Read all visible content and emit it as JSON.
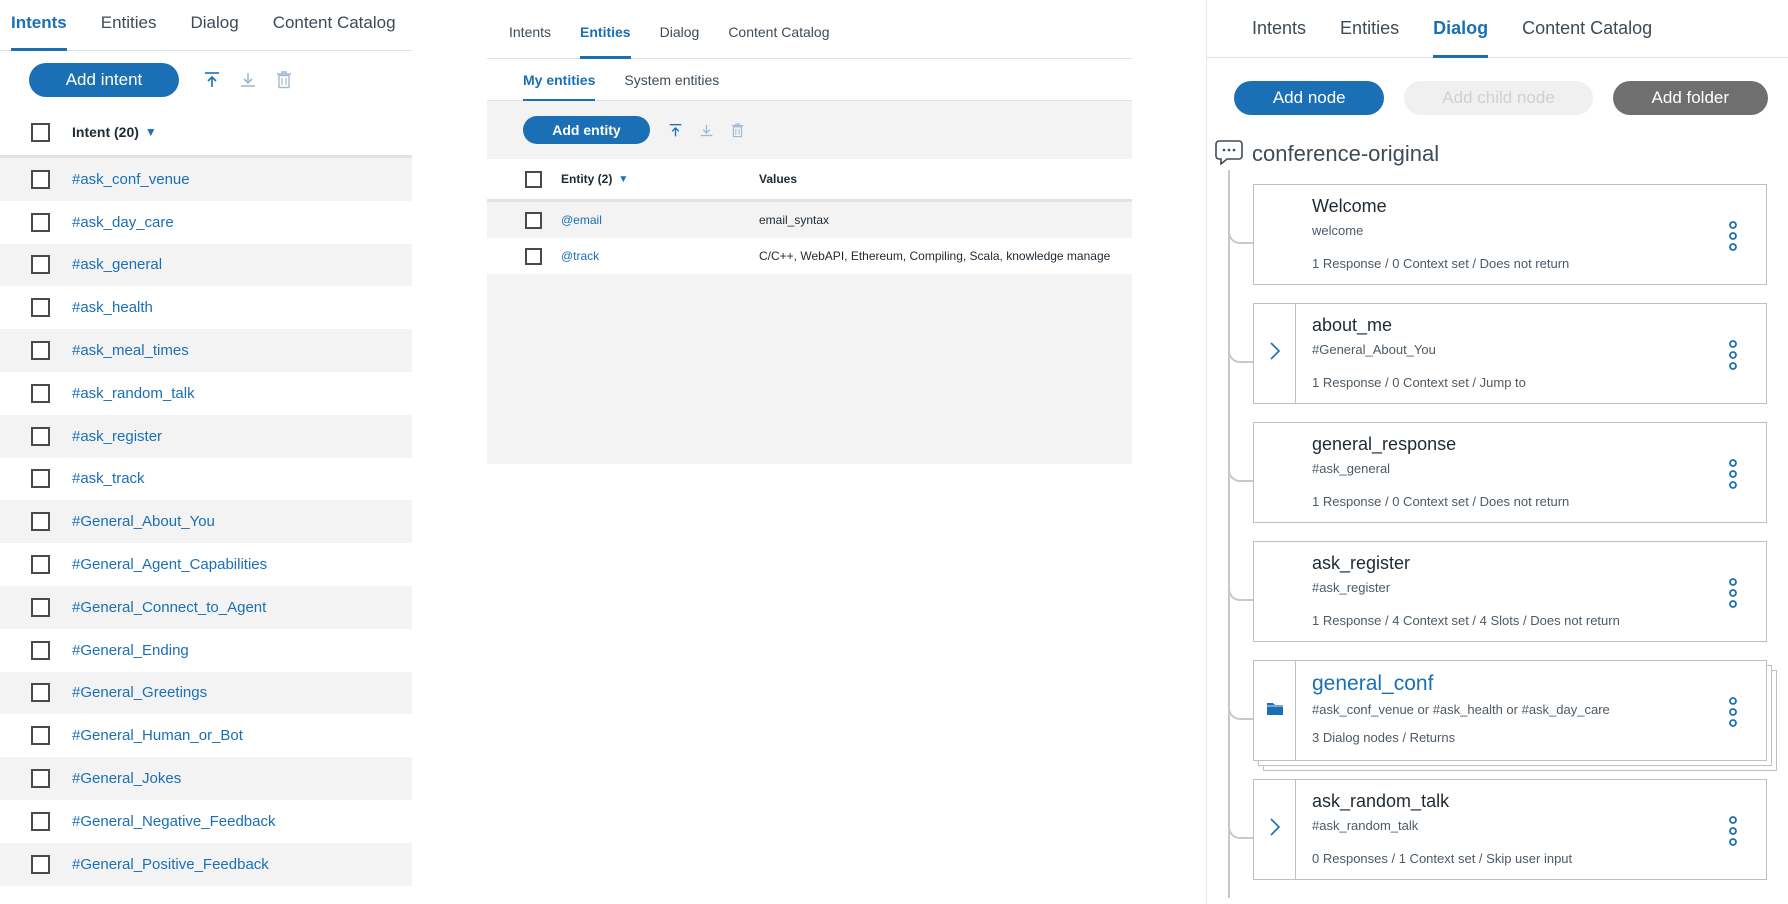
{
  "intents_panel": {
    "tabs": [
      "Intents",
      "Entities",
      "Dialog",
      "Content Catalog"
    ],
    "active_tab": 0,
    "add_button": "Add intent",
    "header_label": "Intent (20)",
    "items": [
      "#ask_conf_venue",
      "#ask_day_care",
      "#ask_general",
      "#ask_health",
      "#ask_meal_times",
      "#ask_random_talk",
      "#ask_register",
      "#ask_track",
      "#General_About_You",
      "#General_Agent_Capabilities",
      "#General_Connect_to_Agent",
      "#General_Ending",
      "#General_Greetings",
      "#General_Human_or_Bot",
      "#General_Jokes",
      "#General_Negative_Feedback",
      "#General_Positive_Feedback"
    ]
  },
  "entities_panel": {
    "tabs": [
      "Intents",
      "Entities",
      "Dialog",
      "Content Catalog"
    ],
    "active_tab": 1,
    "subtabs": [
      "My entities",
      "System entities"
    ],
    "active_subtab": 0,
    "add_button": "Add entity",
    "col_entity": "Entity (2)",
    "col_values": "Values",
    "rows": [
      {
        "name": "@email",
        "values": "email_syntax"
      },
      {
        "name": "@track",
        "values": "C/C++, WebAPI, Ethereum, Compiling, Scala, knowledge manage"
      }
    ]
  },
  "dialog_panel": {
    "tabs": [
      "Intents",
      "Entities",
      "Dialog",
      "Content Catalog"
    ],
    "active_tab": 2,
    "add_node": "Add node",
    "add_child_node": "Add child node",
    "add_folder": "Add folder",
    "workspace_name": "conference-original",
    "nodes": [
      {
        "name": "Welcome",
        "condition": "welcome",
        "meta": "1 Response / 0 Context set / Does not return",
        "gutter": "none"
      },
      {
        "name": "about_me",
        "condition": "#General_About_You",
        "meta": "1 Response / 0 Context set / Jump to",
        "gutter": "chevron"
      },
      {
        "name": "general_response",
        "condition": "#ask_general",
        "meta": "1 Response / 0 Context set / Does not return",
        "gutter": "none"
      },
      {
        "name": "ask_register",
        "condition": "#ask_register",
        "meta": "1 Response / 4 Context set / 4 Slots / Does not return",
        "gutter": "none"
      },
      {
        "name": "general_conf",
        "condition": "#ask_conf_venue or #ask_health or #ask_day_care",
        "meta": "3 Dialog nodes / Returns",
        "gutter": "folder"
      },
      {
        "name": "ask_random_talk",
        "condition": "#ask_random_talk",
        "meta": "0 Responses / 1 Context set / Skip user input",
        "gutter": "chevron"
      }
    ]
  },
  "colors": {
    "accent": "#1a6fb5",
    "row_alt": "#f3f3f3",
    "folder_button": "#6f6f6f"
  }
}
